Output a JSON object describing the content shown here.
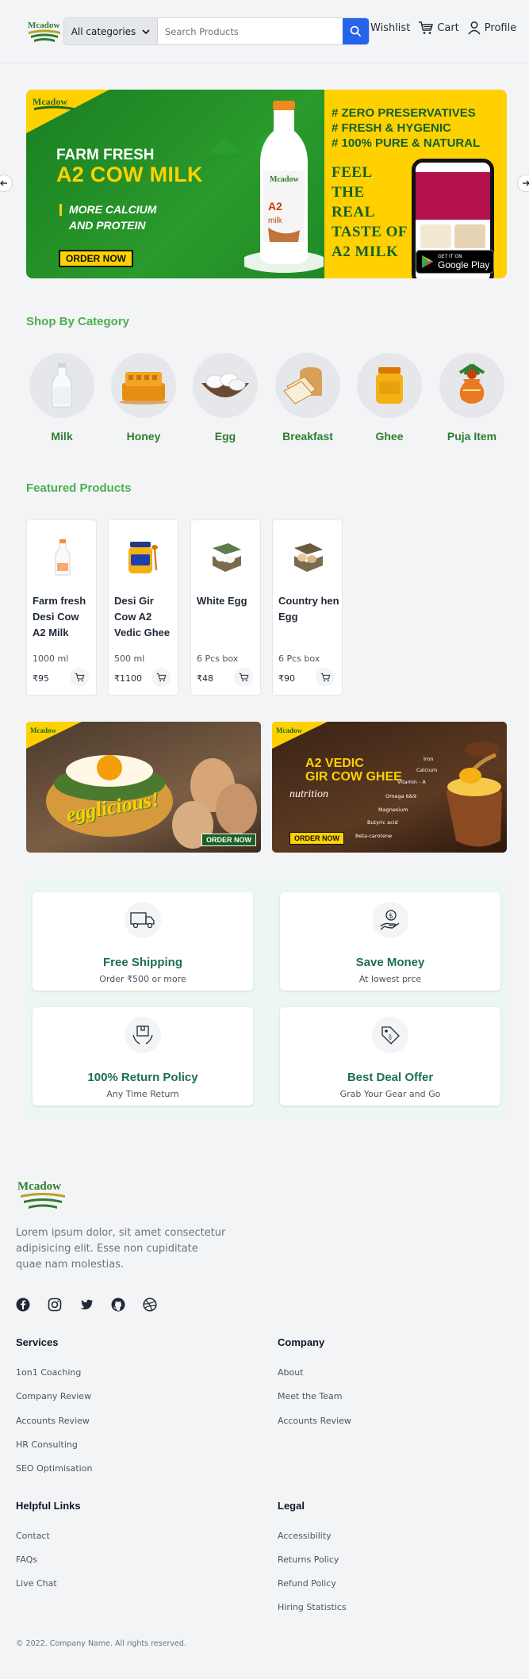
{
  "brand": {
    "name": "Mcadow",
    "accent": "#4caf50",
    "hero_green": "#1f8a25",
    "hero_yellow": "#ffd100",
    "primary_blue": "#2563eb"
  },
  "header": {
    "category_select": "All categories",
    "search_placeholder": "Search Products",
    "wishlist": "Wishlist",
    "cart": "Cart",
    "profile": "Profile"
  },
  "hero": {
    "line1": "FARM FRESH",
    "line2": "A2 COW MILK",
    "line3a": "MORE CALCIUM",
    "line3b": "AND PROTEIN",
    "cta": "ORDER NOW",
    "features": [
      "# ZERO PRESERVATIVES",
      "# FRESH & HYGENIC",
      "# 100% PURE & NATURAL"
    ],
    "tagline": [
      "FEEL",
      "THE",
      "REAL",
      "TASTE OF",
      "A2 MILK"
    ],
    "gplay_small": "GET IT ON",
    "gplay_big": "Google Play"
  },
  "categories_title": "Shop By Category",
  "categories": [
    {
      "label": "Milk",
      "icon": "milk-bottle-icon"
    },
    {
      "label": "Honey",
      "icon": "honeycomb-icon"
    },
    {
      "label": "Egg",
      "icon": "eggs-bowl-icon"
    },
    {
      "label": "Breakfast",
      "icon": "bread-icon"
    },
    {
      "label": "Ghee",
      "icon": "ghee-jar-icon"
    },
    {
      "label": "Puja Item",
      "icon": "kalash-icon"
    }
  ],
  "featured_title": "Featured Products",
  "products": [
    {
      "name": "Farm fresh Desi Cow A2 Milk",
      "unit": "1000 ml",
      "price": "₹95"
    },
    {
      "name": "Desi Gir Cow A2 Vedic Ghee",
      "unit": "500 ml",
      "price": "₹1100"
    },
    {
      "name": "White Egg",
      "unit": "6 Pcs box",
      "price": "₹48"
    },
    {
      "name": "Country hen Egg",
      "unit": "6 Pcs box",
      "price": "₹90"
    }
  ],
  "promos": [
    {
      "headline": "egglicious!",
      "cta": "ORDER NOW"
    },
    {
      "headline_a": "A2 VEDIC",
      "headline_b": "GIR COW GHEE",
      "sub": "nutrition",
      "cta": "ORDER NOW",
      "nutrients": [
        "Iron",
        "Calcium",
        "Vitamin - A",
        "Omega 6&9",
        "Magnesium",
        "Butyric acid",
        "Beta-carotene"
      ]
    }
  ],
  "features": [
    {
      "title": "Free Shipping",
      "sub": "Order ₹500 or more",
      "icon": "truck-icon"
    },
    {
      "title": "Save Money",
      "sub": "At lowest prce",
      "icon": "money-hand-icon"
    },
    {
      "title": "100% Return Policy",
      "sub": "Any Time Return",
      "icon": "return-box-icon"
    },
    {
      "title": "Best Deal Offer",
      "sub": "Grab Your Gear and Go",
      "icon": "discount-tag-icon"
    }
  ],
  "footer": {
    "description": "Lorem ipsum dolor, sit amet consectetur adipisicing elit. Esse non cupiditate quae nam molestias.",
    "services_title": "Services",
    "services": [
      "1on1 Coaching",
      "Company Review",
      "Accounts Review",
      "HR Consulting",
      "SEO Optimisation"
    ],
    "company_title": "Company",
    "company": [
      "About",
      "Meet the Team",
      "Accounts Review"
    ],
    "helpful_title": "Helpful Links",
    "helpful": [
      "Contact",
      "FAQs",
      "Live Chat"
    ],
    "legal_title": "Legal",
    "legal": [
      "Accessibility",
      "Returns Policy",
      "Refund Policy",
      "Hiring Statistics"
    ],
    "copyright": "© 2022. Company Name. All rights reserved."
  }
}
